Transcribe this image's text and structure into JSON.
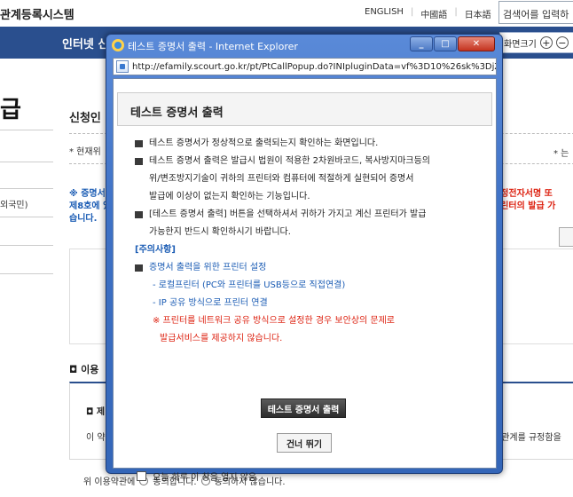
{
  "site": {
    "title": "관계등록시스템",
    "languages": [
      "ENGLISH",
      "中國語",
      "日本語"
    ],
    "search_placeholder": "검색어를 입력하",
    "nav_item": "인터넷 신",
    "zoom_label": "화면크기",
    "zoom_in": "+",
    "zoom_out": "−",
    "big_heading": "급",
    "left_text": "외국민)",
    "sub_title": "신청인",
    "current_loc": "* 현재위",
    "right_note": "* 는",
    "notice_blue": "※ 증명서 제8호에 있습니다.",
    "notice_red_1": "행정전자서명 또",
    "notice_red_2": "프린터의 발급 가",
    "terms_head": "이용",
    "terms_sub": "제",
    "terms_text": "이 약",
    "terms_right": "용관계를 규정함을",
    "agree_label": "위 이용약관에",
    "agree_yes": "동의합니다.",
    "agree_no": "동의하지 않습니다."
  },
  "popup": {
    "window_title": "테스트 증명서 출력 - Internet Explorer",
    "url": "http://efamily.scourt.go.kr/pt/PtCallPopup.do?INIpluginData=vf%3D10%26sk%3DjZA3N",
    "heading": "테스트 증명서 출력",
    "lines": {
      "b1": "테스트 증명서가 정상적으로 출력되는지 확인하는 화면입니다.",
      "b2": "테스트 증명서 출력은 발급시 법원이 적용한 2차원바코드, 복사방지마크등의",
      "b2c1": "위/변조방지기술이 귀하의 프린터와 컴퓨터에 적절하게 실현되어 증명서",
      "b2c2": "발급에 이상이 없는지 확인하는 기능입니다.",
      "b3": "[테스트 증명서 출력] 버튼을 선택하셔서 귀하가 가지고 계신 프린터가 발급",
      "b3c1": "가능한지 반드시 확인하시기 바랍니다.",
      "caution": "[주의사항]",
      "b4": "증명서 출력을 위한 프린터 설정",
      "s1": "- 로컬프린터 (PC와 프린터를 USB등으로 직접연결)",
      "s2": "- IP 공유 방식으로 프린터 연결",
      "warn1": "※ 프린터를 네트워크 공유 방식으로 설정한 경우 보안상의 문제로",
      "warn2": "발급서비스를 제공하지 않습니다."
    },
    "print_button": "테스트 증명서 출력",
    "skip_button": "건너 뛰기",
    "no_show_label": "오늘 하루 이 창을 열지 않음"
  }
}
